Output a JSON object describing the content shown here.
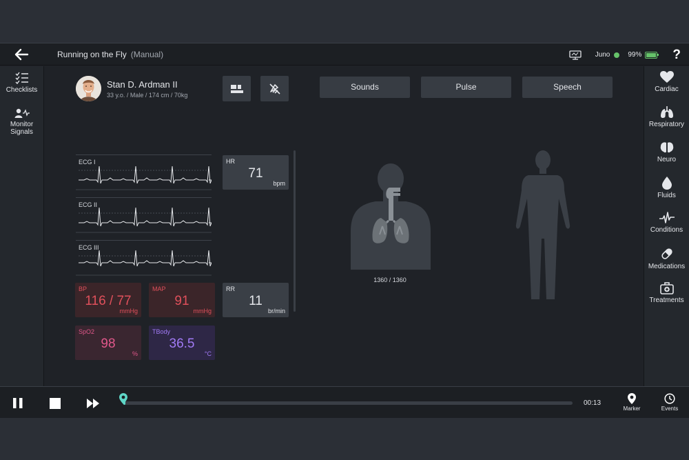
{
  "header": {
    "title": "Running on the Fly",
    "mode": "(Manual)",
    "user": "Juno",
    "battery": "99%",
    "battery_level": 0.99,
    "help": "?"
  },
  "left_nav": {
    "items": [
      {
        "label": "Checklists",
        "icon": "checklist-icon"
      },
      {
        "label": "Monitor Signals",
        "icon": "monitor-signals-icon"
      }
    ]
  },
  "right_nav": {
    "items": [
      {
        "label": "Cardiac",
        "icon": "heart-icon"
      },
      {
        "label": "Respiratory",
        "icon": "lungs-icon"
      },
      {
        "label": "Neuro",
        "icon": "brain-icon"
      },
      {
        "label": "Fluids",
        "icon": "drop-icon"
      },
      {
        "label": "Conditions",
        "icon": "pulse-wave-icon"
      },
      {
        "label": "Medications",
        "icon": "pill-icon"
      },
      {
        "label": "Treatments",
        "icon": "medkit-icon"
      }
    ]
  },
  "patient": {
    "name": "Stan D. Ardman II",
    "info": "33 y.o. / Male / 174 cm / 70kg"
  },
  "ecg": [
    {
      "label": "ECG I"
    },
    {
      "label": "ECG II"
    },
    {
      "label": "ECG III"
    }
  ],
  "vitals": {
    "hr": {
      "label": "HR",
      "value": "71",
      "unit": "bpm"
    },
    "rr": {
      "label": "RR",
      "value": "11",
      "unit": "br/min"
    },
    "bp": {
      "label": "BP",
      "value": "116 / 77",
      "unit": "mmHg"
    },
    "map": {
      "label": "MAP",
      "value": "91",
      "unit": "mmHg"
    },
    "spo2": {
      "label": "SpO2",
      "value": "98",
      "unit": "%"
    },
    "tbody": {
      "label": "TBody",
      "value": "36.5",
      "unit": "°C"
    }
  },
  "tabs": [
    {
      "label": "Sounds"
    },
    {
      "label": "Pulse"
    },
    {
      "label": "Speech"
    }
  ],
  "lung_volume": "1360 / 1360",
  "playback": {
    "time": "00:13",
    "progress": 0.003,
    "marker_label": "Marker",
    "events_label": "Events"
  },
  "colors": {
    "bp": "#d94a55",
    "spo2": "#d9507e",
    "tbody": "#9b6cf0",
    "accent": "#5fd6c7",
    "status_ok": "#66c26a"
  }
}
